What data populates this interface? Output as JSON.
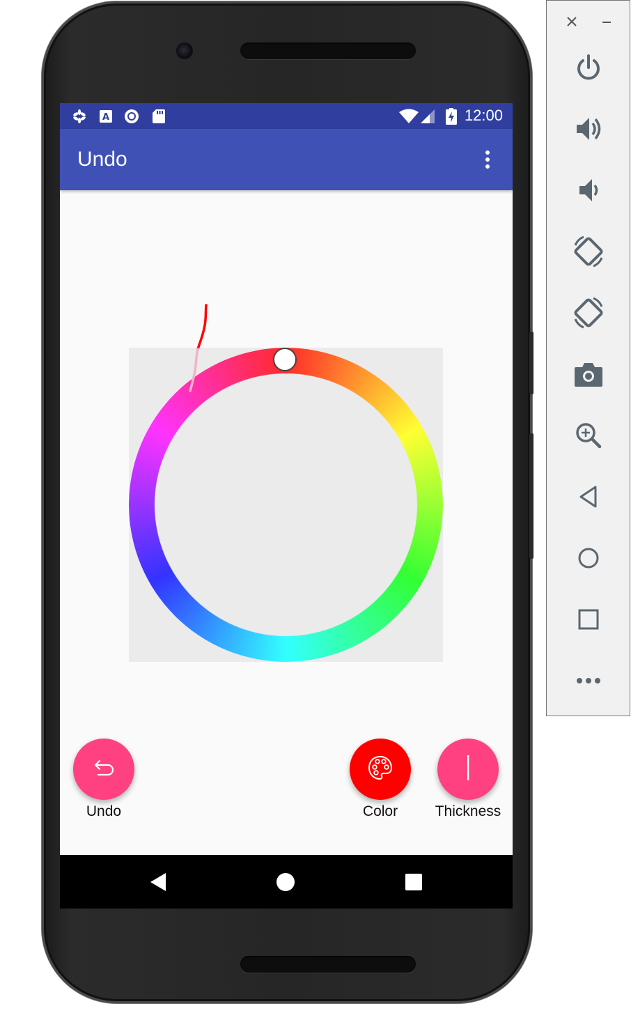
{
  "status_bar": {
    "time": "12:00",
    "icons": [
      "pinwheel-icon",
      "text-a-icon",
      "record-icon",
      "sd-card-icon",
      "wifi-icon",
      "cell-signal-icon",
      "battery-charging-icon"
    ]
  },
  "app_bar": {
    "title": "Undo",
    "menu_icon": "more-vert-icon"
  },
  "color_picker": {
    "ring_hues": [
      "#ff2a2a",
      "#ffff33",
      "#33ff33",
      "#33ffff",
      "#3333ff",
      "#ff33ff"
    ],
    "stroke_color": "#ff0000"
  },
  "buttons": {
    "undo_label": "Undo",
    "color_label": "Color",
    "thickness_label": "Thickness",
    "undo_color": "#ff4081",
    "color_button_color": "#ff0000",
    "thickness_color": "#ff4081"
  },
  "nav_bar": {
    "icons": [
      "back-icon",
      "home-icon",
      "recents-icon"
    ]
  },
  "emulator_panel": {
    "window_controls": [
      "close-icon",
      "minimize-icon"
    ],
    "items": [
      "power-icon",
      "volume-up-icon",
      "volume-down-icon",
      "rotate-left-icon",
      "rotate-right-icon",
      "camera-icon",
      "zoom-icon",
      "back-icon",
      "home-icon",
      "overview-icon",
      "more-icon"
    ]
  }
}
